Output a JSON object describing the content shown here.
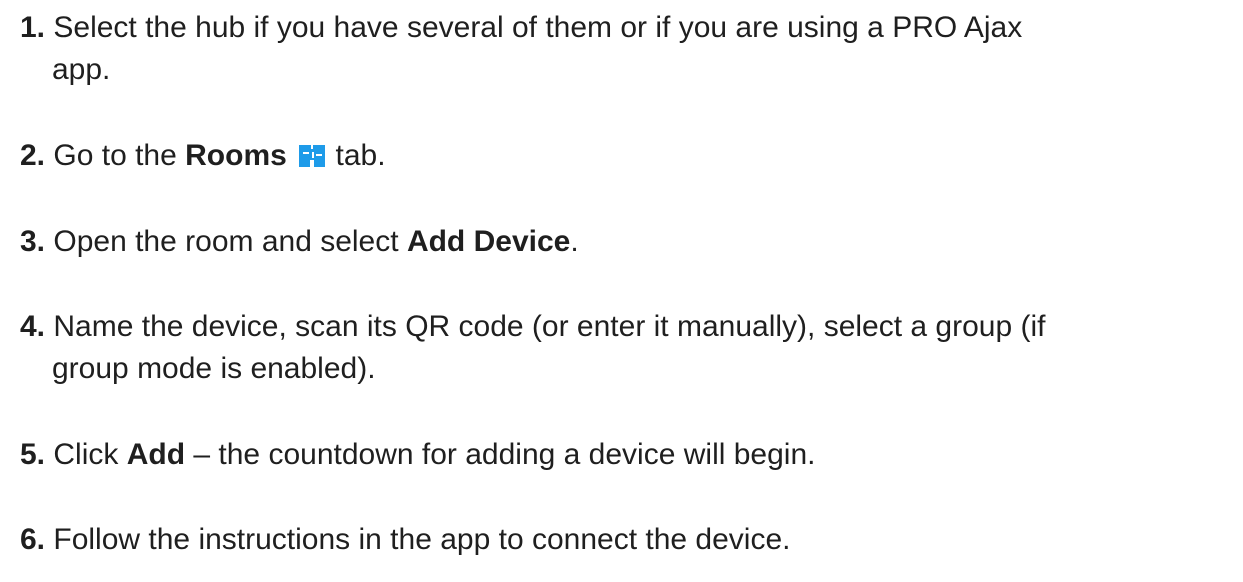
{
  "steps": [
    {
      "number": "1.",
      "text_line1": "Select the hub if you have several of them or if you are using a PRO Ajax",
      "text_line2": "app."
    },
    {
      "number": "2.",
      "before": "Go to the",
      "bold": "Rooms",
      "icon": "rooms-icon",
      "after": "tab."
    },
    {
      "number": "3.",
      "before": "Open the room and select",
      "bold": "Add Device",
      "after": "."
    },
    {
      "number": "4.",
      "text_line1": "Name the device, scan its QR code (or enter it manually), select a group (if",
      "text_line2": "group mode is enabled)."
    },
    {
      "number": "5.",
      "before": "Click",
      "bold": "Add",
      "after": "– the countdown for adding a device will begin."
    },
    {
      "number": "6.",
      "text": "Follow the instructions in the app to connect the device."
    }
  ],
  "colors": {
    "text": "#1f1f1f",
    "icon_blue": "#1e9be9"
  }
}
